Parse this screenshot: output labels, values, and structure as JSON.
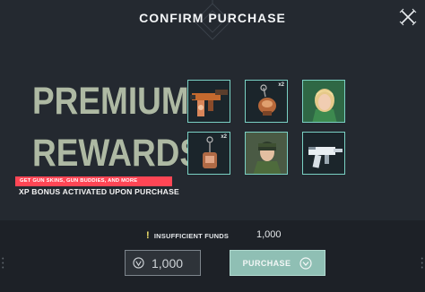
{
  "header": {
    "title": "CONFIRM PURCHASE"
  },
  "bundle": {
    "heading_line1": "PREMIUM",
    "heading_line2": "REWARDS",
    "promo_badge": "GET GUN SKINS, GUN BUDDIES, AND MORE",
    "xp_bonus": "XP BONUS ACTIVATED UPON PURCHASE"
  },
  "rewards": [
    {
      "name": "gun-skin-rifle",
      "qty": ""
    },
    {
      "name": "gun-buddy-charm",
      "qty": "x2"
    },
    {
      "name": "player-card-blonde-agent",
      "qty": ""
    },
    {
      "name": "gun-buddy-keychain",
      "qty": "x2"
    },
    {
      "name": "player-card-green-agent",
      "qty": ""
    },
    {
      "name": "gun-skin-smg",
      "qty": ""
    }
  ],
  "footer": {
    "warning": "INSUFFICIENT FUNDS",
    "cost": "1,000",
    "balance": "1,000",
    "purchase_label": "PURCHASE"
  },
  "colors": {
    "accent": "#7ad1c4",
    "promo": "#ff4655",
    "premium_text": "#aeb9a3",
    "purchase_button": "#8fbfb4"
  },
  "icons": [
    "close-icon",
    "warning-icon",
    "valorant-points-icon",
    "chevron-down-icon"
  ]
}
